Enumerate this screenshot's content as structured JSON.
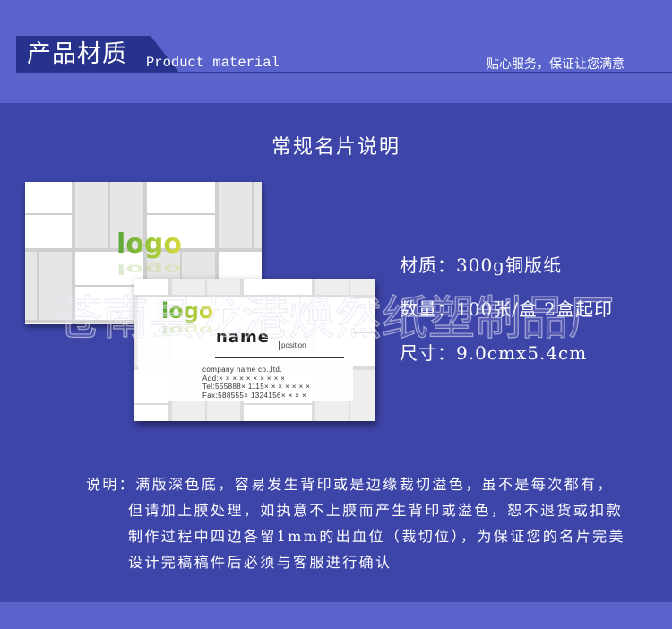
{
  "header": {
    "title_cn": "产品材质",
    "title_en": "Product material",
    "slogan": "贴心服务，保证让您满意"
  },
  "section_title": "常规名片说明",
  "card_back": {
    "logo": "logo"
  },
  "card_front": {
    "logo": "logo",
    "name": "name",
    "position": "position",
    "company": "company name co.,ltd.",
    "address": "Add:× × × × × × × × × ×",
    "tel": "Tel:555888× 1115× × × × × × ×",
    "fax": "Fax:588555× 1324156× × × ×"
  },
  "specs": [
    "材质：300g铜版纸",
    "数量：100张/盒  2盒起印",
    "尺寸：9.0cmx5.4cm"
  ],
  "notes": [
    "说明：满版深色底，容易发生背印或是边缘裁切溢色，虽不是每次都有，",
    "但请加上膜处理，如执意不上膜而产生背印或溢色，恕不退货或扣款",
    "制作过程中四边各留1mm的出血位（裁切位），为保证您的名片完美",
    "设计完稿稿件后必须与客服进行确认"
  ],
  "watermark": "苍南县龙港焕然纸塑制品厂",
  "colors": {
    "top_band": "#5a63cc",
    "main_background": "#3e45a9",
    "header_tab": "#27328c",
    "text": "#ffffff",
    "logo_green": "#5aa53a",
    "logo_yellow": "#d8d83c"
  }
}
